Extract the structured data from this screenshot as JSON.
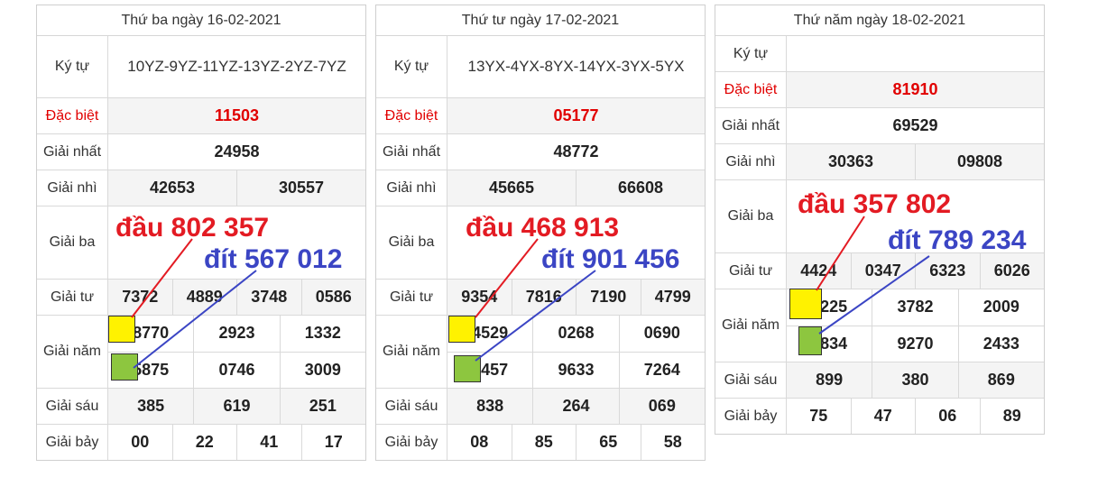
{
  "colors": {
    "red_note": "#e31b23",
    "blue_note": "#3b45c4",
    "special": "#e10000",
    "yellow_box": "#fff200",
    "green_box": "#8dc63f"
  },
  "tables": [
    {
      "date": "Thứ ba ngày 16-02-2021",
      "ky_tu_label": "Ký tự",
      "ky_tu": "10YZ-9YZ-11YZ-13YZ-2YZ-7YZ",
      "dac_biet_label": "Đặc biệt",
      "dac_biet": "11503",
      "nhat_label": "Giải nhất",
      "nhat": "24958",
      "nhi_label": "Giải nhì",
      "nhi": [
        "42653",
        "30557"
      ],
      "ba_label": "Giải ba",
      "tu_label": "Giải tư",
      "tu": [
        "7372",
        "4889",
        "3748",
        "0586"
      ],
      "nam_label": "Giải năm",
      "nam": [
        "8770",
        "2923",
        "1332",
        "5875",
        "0746",
        "3009"
      ],
      "sau_label": "Giải sáu",
      "sau": [
        "385",
        "619",
        "251"
      ],
      "bay_label": "Giải bảy",
      "bay": [
        "00",
        "22",
        "41",
        "17"
      ],
      "note_dau": "đầu 802 357",
      "note_dit": "đít 567 012"
    },
    {
      "date": "Thứ tư ngày 17-02-2021",
      "ky_tu_label": "Ký tự",
      "ky_tu": "13YX-4YX-8YX-14YX-3YX-5YX",
      "dac_biet_label": "Đặc biệt",
      "dac_biet": "05177",
      "nhat_label": "Giải nhất",
      "nhat": "48772",
      "nhi_label": "Giải nhì",
      "nhi": [
        "45665",
        "66608"
      ],
      "ba_label": "Giải ba",
      "tu_label": "Giải tư",
      "tu": [
        "9354",
        "7816",
        "7190",
        "4799"
      ],
      "nam_label": "Giải năm",
      "nam": [
        "4529",
        "0268",
        "0690",
        "9457",
        "9633",
        "7264"
      ],
      "sau_label": "Giải sáu",
      "sau": [
        "838",
        "264",
        "069"
      ],
      "bay_label": "Giải bảy",
      "bay": [
        "08",
        "85",
        "65",
        "58"
      ],
      "note_dau": "đầu 468 913",
      "note_dit": "đít 901 456"
    },
    {
      "date": "Thứ năm ngày 18-02-2021",
      "ky_tu_label": "Ký tự",
      "ky_tu": "",
      "dac_biet_label": "Đặc biệt",
      "dac_biet": "81910",
      "nhat_label": "Giải nhất",
      "nhat": "69529",
      "nhi_label": "Giải nhì",
      "nhi": [
        "30363",
        "09808"
      ],
      "ba_label": "Giải ba",
      "tu_label": "Giải tư",
      "tu": [
        "4424",
        "0347",
        "6323",
        "6026"
      ],
      "nam_label": "Giải năm",
      "nam": [
        "3225",
        "3782",
        "2009",
        "7834",
        "9270",
        "2433"
      ],
      "sau_label": "Giải sáu",
      "sau": [
        "899",
        "380",
        "869"
      ],
      "bay_label": "Giải bảy",
      "bay": [
        "75",
        "47",
        "06",
        "89"
      ],
      "note_dau": "đầu 357 802",
      "note_dit": "đít 789 234"
    }
  ]
}
